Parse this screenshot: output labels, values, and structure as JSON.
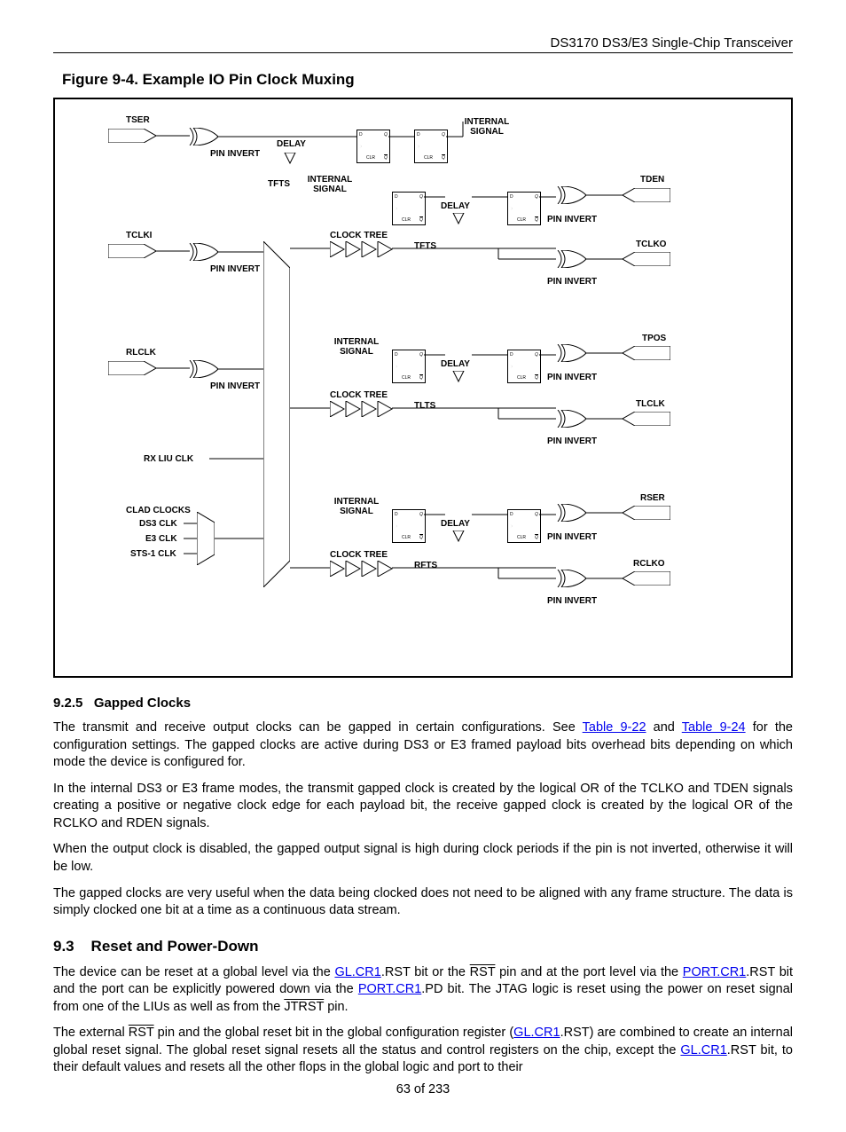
{
  "header": {
    "doc_title": "DS3170 DS3/E3 Single-Chip Transceiver"
  },
  "figure": {
    "caption": "Figure 9-4. Example IO Pin Clock Muxing",
    "labels": {
      "tser": "TSER",
      "tclki": "TCLKI",
      "rlclk": "RLCLK",
      "rx_liu_clk": "RX LIU CLK",
      "clad_clocks": "CLAD CLOCKS",
      "ds3_clk": "DS3 CLK",
      "e3_clk": "E3 CLK",
      "sts1_clk": "STS-1 CLK",
      "pin_invert": "PIN INVERT",
      "delay": "DELAY",
      "internal_signal": "INTERNAL SIGNAL",
      "tfts": "TFTS",
      "clock_tree": "CLOCK  TREE",
      "tlts": "TLTS",
      "rfts": "RFTS",
      "tden": "TDEN",
      "tclko": "TCLKO",
      "tpos": "TPOS",
      "tlclk": "TLCLK",
      "rser": "RSER",
      "rclko": "RCLKO"
    }
  },
  "sections": {
    "s925": {
      "num": "9.2.5",
      "title": "Gapped Clocks",
      "p1a": "The transmit and receive output clocks can be gapped in certain configurations. See ",
      "link1": "Table 9-22",
      "p1b": " and ",
      "link2": "Table 9-24",
      "p1c": " for the configuration settings. The gapped clocks are active during DS3 or E3 framed payload bits overhead bits depending on which mode the device is configured for.",
      "p2": "In the internal DS3 or E3 frame modes, the transmit gapped clock is created by the logical OR of the TCLKO and TDEN signals creating a positive or negative clock edge for each payload bit, the receive gapped clock is created by the logical OR of the RCLKO and RDEN signals.",
      "p3": "When the output clock is disabled, the gapped output signal is high during clock periods if the pin is not inverted, otherwise it will be low.",
      "p4": "The gapped clocks are very useful when the data being clocked does not need to be aligned with any frame structure. The data is simply clocked one bit at a time as a continuous data stream."
    },
    "s93": {
      "num": "9.3",
      "title": "Reset and Power-Down",
      "p1a": "The device can be reset at a global level via the ",
      "link1": "GL.CR1",
      "p1b": ".RST bit or the ",
      "rst1": "RST",
      "p1c": " pin and at the port level via the ",
      "link2": "PORT.CR1",
      "p1d": ".RST bit and the port can be explicitly powered down via the ",
      "link3": "PORT.CR1",
      "p1e": ".PD bit. The JTAG logic is reset using the power on reset signal from one of the LIUs as well as from the ",
      "jtrst": "JTRST",
      "p1f": " pin.",
      "p2a": "The external ",
      "rst2": "RST",
      "p2b": " pin and the global reset bit in the global configuration register (",
      "link4": "GL.CR1",
      "p2c": ".RST) are combined to create an internal global reset signal. The global reset signal resets all the status and control registers on the chip, except the ",
      "link5": "GL.CR1",
      "p2d": ".RST bit,  to their default values and resets all the other flops in the global logic and port to their"
    }
  },
  "footer": {
    "page": "63 of 233"
  }
}
